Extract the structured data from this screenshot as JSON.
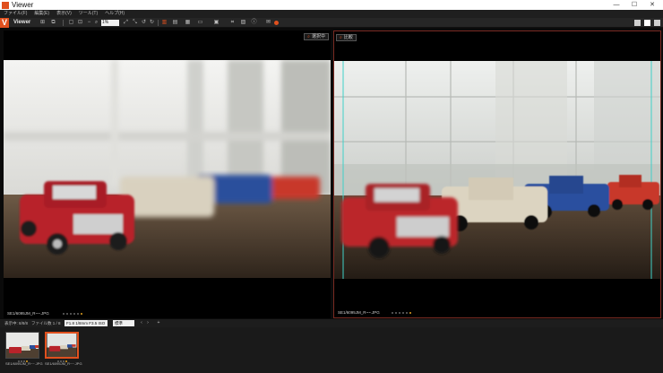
{
  "window": {
    "title": "Viewer",
    "minimize": "—",
    "maximize": "☐",
    "close": "✕"
  },
  "menu": [
    "ファイル(F)",
    "編集(E)",
    "表示(V)",
    "ツール(T)",
    "ヘルプ(H)"
  ],
  "toolbar": {
    "mode_label": "Viewer",
    "zoom_value": "1%",
    "icons": [
      "grid-icon",
      "compare-icon",
      "zoom-out-icon",
      "zoom-in-icon",
      "fit-icon",
      "actual-size-icon",
      "rotate-left-icon",
      "rotate-right-icon",
      "panel-icon",
      "mail-icon",
      "record-icon"
    ],
    "layout_buttons": [
      "single-view",
      "side-by-side",
      "filmstrip"
    ]
  },
  "panes": {
    "left": {
      "tag": "選択中",
      "filename": "SE1/6095JM_R~~.JPG"
    },
    "right": {
      "tag": "比較",
      "filename": "SE1/6095JM_R~~.JPG"
    }
  },
  "infobar": {
    "folder_label": "表示中: 8/8/8",
    "count_label": "ファイル数 1 / 8",
    "filter_value": "F1.8 1/8mm F3.5 ISO",
    "sort_value": "標準",
    "nav_prev": "‹",
    "nav_next": "›",
    "add": "+"
  },
  "filmstrip": [
    {
      "name": "SE1/6095JM_R~~.JPG",
      "selected": false
    },
    {
      "name": "SE1/6095JM_R~~.JPG",
      "selected": true
    }
  ],
  "colors": {
    "accent": "#e0501e",
    "rating": "#e0a020"
  }
}
